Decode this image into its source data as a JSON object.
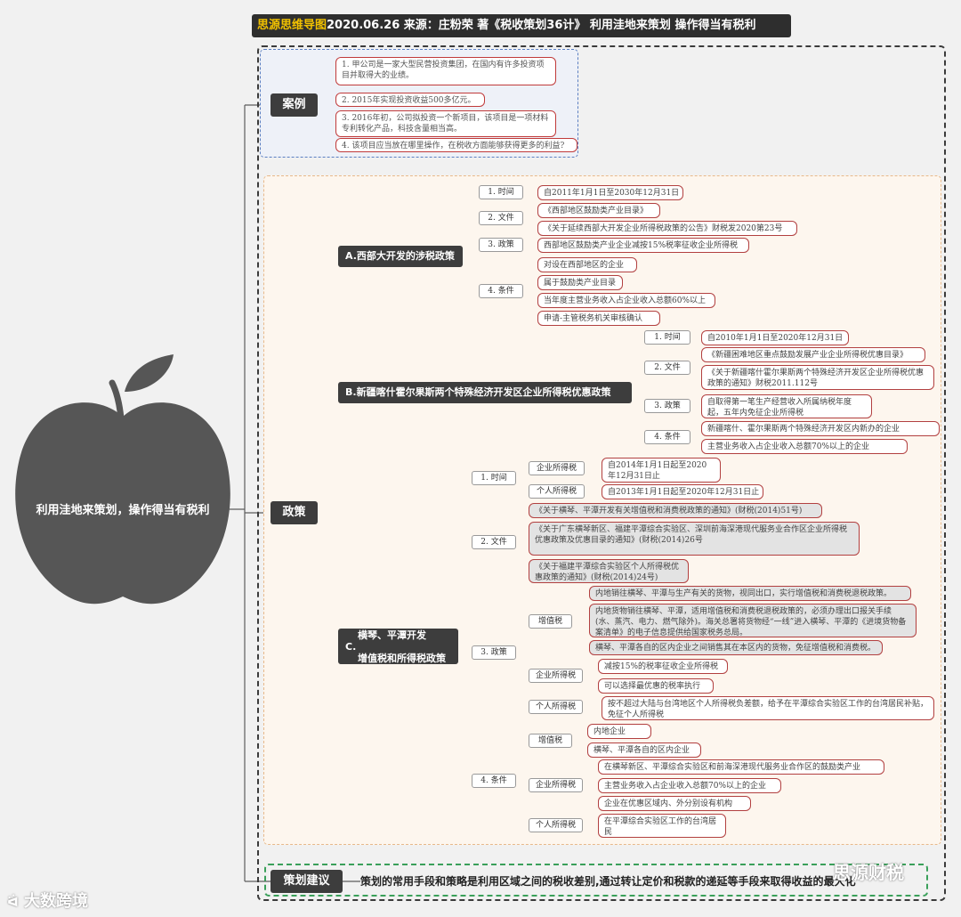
{
  "banner": {
    "prefix": "思源思维导图",
    "rest": "2020.06.26  来源：庄粉荣 著《税收策划36计》 利用洼地来策划  操作得当有税利"
  },
  "root": {
    "label": "利用洼地来策划，操作得当有税利",
    "shape": "apple-icon",
    "color": "#565656"
  },
  "sections": {
    "case": "案例",
    "policy": "政策",
    "advice": "策划建议"
  },
  "case_items": [
    "1. 甲公司是一家大型民营投资集团，在国内有许多投资项目并取得大的业绩。",
    "2. 2015年实现投资收益500多亿元。",
    "3. 2016年初，公司拟投资一个新项目，该项目是一项材料专利转化产品，科技含量相当高。",
    "4. 该项目应当放在哪里操作，在税收方面能够获得更多的利益?"
  ],
  "policy_a": {
    "title": "A.西部大开发的涉税政策",
    "labels": [
      "1. 时间",
      "2. 文件",
      "3. 政策",
      "4. 条件"
    ],
    "time": "自2011年1月1日至2030年12月31日",
    "docs": [
      "《西部地区鼓励类产业目录》",
      "《关于延续西部大开发企业所得税政策的公告》财税发2020第23号"
    ],
    "policy": "西部地区鼓励类产业企业减按15%税率征收企业所得税",
    "conditions": [
      "对设在西部地区的企业",
      "属于鼓励类产业目录",
      "当年度主营业务收入占企业收入总额60%以上",
      "申请-主管税务机关审核确认"
    ]
  },
  "policy_b": {
    "title": "B.新疆喀什霍尔果斯两个特殊经济开发区企业所得税优惠政策",
    "labels": [
      "1. 时间",
      "2. 文件",
      "3. 政策",
      "4. 条件"
    ],
    "time": "自2010年1月1日至2020年12月31日",
    "docs": [
      "《新疆困难地区重点鼓励发展产业企业所得税优惠目录》",
      "《关于新疆喀什霍尔果斯两个特殊经济开发区企业所得税优惠政策的通知》财税2011.112号"
    ],
    "policy": "自取得第一笔生产经营收入所属纳税年度起，五年内免征企业所得税",
    "conditions": [
      "新疆喀什、霍尔果斯两个特殊经济开发区内新办的企业",
      "主营业务收入占企业收入总额70%以上的企业"
    ]
  },
  "policy_c": {
    "title1": "横琴、平潭开发",
    "title_c": "C.",
    "title2": "增值税和所得税政策",
    "labels": [
      "1. 时间",
      "2. 文件",
      "3. 政策",
      "4. 条件"
    ],
    "time_sub": [
      "企业所得税",
      "个人所得税"
    ],
    "time_vals": [
      "自2014年1月1日起至2020年12月31日止",
      "自2013年1月1日起至2020年12月31日止"
    ],
    "docs": [
      "《关于横琴、平潭开发有关增值税和消费税政策的通知》(财税(2014)51号)",
      "《关于广东横琴新区、福建平潭综合实验区、深圳前海深港现代服务业合作区企业所得税优惠政策及优惠目录的通知》(财税(2014)26号",
      "《关于福建平潭综合实验区个人所得税优惠政策的通知》(财税(2014)24号)"
    ],
    "policy_sub": [
      "增值税",
      "企业所得税",
      "个人所得税"
    ],
    "policy_vat": [
      "内地销往横琴、平潭与生产有关的货物，视同出口，实行增值税和消费税退税政策。",
      "内地货物销往横琴、平潭，适用增值税和消费税退税政策的，必须办理出口报关手续(水、蒸汽、电力、燃气除外)。海关总署将货物经“一线”进入横琴、平潭的《进境货物备案清单》的电子信息提供给国家税务总局。",
      "横琴、平潭各自的区内企业之间销售其在本区内的货物，免征增值税和消费税。"
    ],
    "policy_cit": [
      "减按15%的税率征收企业所得税",
      "可以选择最优惠的税率执行"
    ],
    "policy_iit": "按不超过大陆与台湾地区个人所得税负差额，给予在平潭综合实验区工作的台湾居民补贴，免征个人所得税",
    "cond_sub": [
      "增值税",
      "企业所得税",
      "个人所得税"
    ],
    "cond_vat": [
      "内地企业",
      "横琴、平潭各自的区内企业"
    ],
    "cond_cit": [
      "在横琴新区、平潭综合实验区和前海深港现代服务业合作区的鼓励类产业",
      "主营业务收入占企业收入总额70%以上的企业",
      "企业在优惠区域内、外分别设有机构"
    ],
    "cond_iit": "在平潭综合实验区工作的台湾居民"
  },
  "advice": "策划的常用手段和策略是利用区域之间的税收差别,通过转让定价和税款的递延等手段来取得收益的最大化",
  "watermarks": {
    "left": "大数跨境",
    "right": "思源财税"
  }
}
